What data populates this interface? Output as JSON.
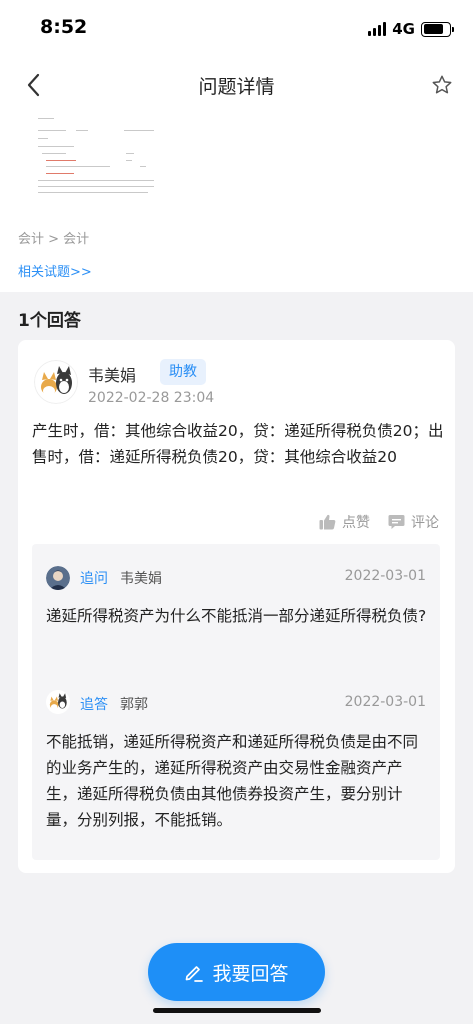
{
  "status_bar": {
    "time": "8:52",
    "network": "4G"
  },
  "nav": {
    "title": "问题详情"
  },
  "question": {
    "breadcrumb": "会计 > 会计",
    "related_link": "相关试题>>"
  },
  "answers_header": "1个回答",
  "answer": {
    "author": "韦美娟",
    "role": "助教",
    "time": "2022-02-28 23:04",
    "content": "产生时，借：其他综合收益20，贷：递延所得税负债20；出售时，借：递延所得税负债20，贷：其他综合收益20",
    "like_label": "点赞",
    "comment_label": "评论"
  },
  "followups": [
    {
      "type": "追问",
      "name": "韦美娟",
      "date": "2022-03-01",
      "text": "递延所得税资产为什么不能抵消一部分递延所得税负债?"
    },
    {
      "type": "追答",
      "name": "郭郭",
      "date": "2022-03-01",
      "text": "不能抵销，递延所得税资产和递延所得税负债是由不同的业务产生的，递延所得税资产由交易性金融资产产生，递延所得税负债由其他债券投资产生，要分别计量，分别列报，不能抵销。"
    }
  ],
  "answer_button": "我要回答",
  "colors": {
    "accent": "#2b8ff5",
    "button": "#1e8ff7",
    "badge_bg": "#e8f1fd"
  }
}
